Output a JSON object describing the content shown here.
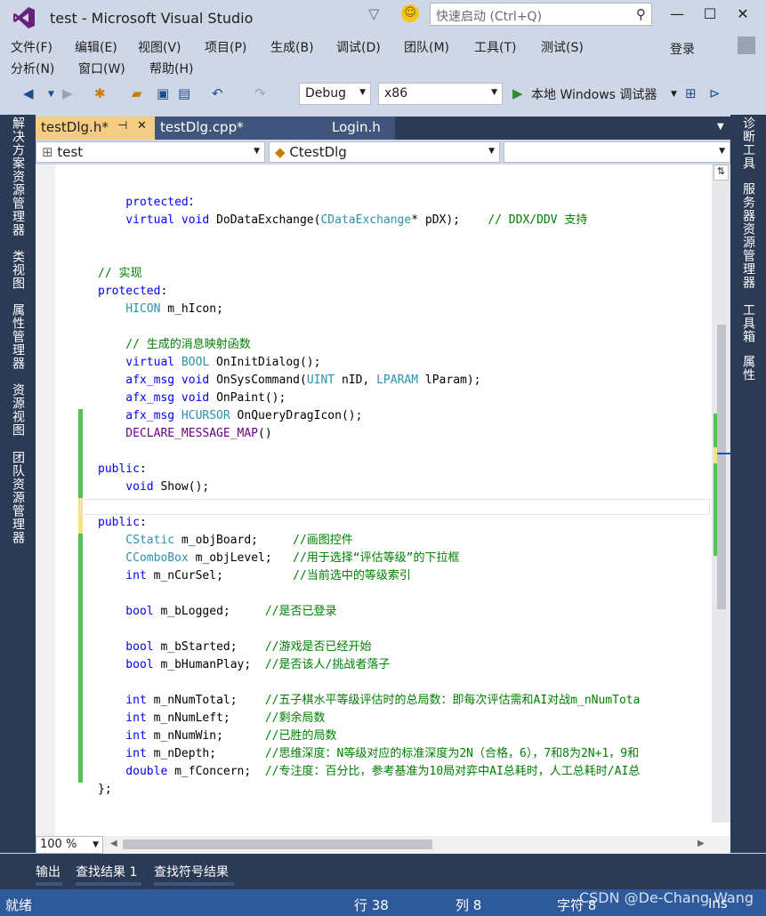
{
  "window": {
    "title": "test - Microsoft Visual Studio",
    "quick_launch_placeholder": "快速启动 (Ctrl+Q)",
    "min_icon": "minimize-icon",
    "max_icon": "maximize-icon",
    "close_icon": "close-icon"
  },
  "menu": {
    "row1": [
      "文件(F)",
      "编辑(E)",
      "视图(V)",
      "项目(P)",
      "生成(B)",
      "调试(D)",
      "团队(M)",
      "工具(T)",
      "测试(S)"
    ],
    "row2": [
      "分析(N)",
      "窗口(W)",
      "帮助(H)"
    ],
    "login": "登录"
  },
  "toolbar": {
    "config": "Debug",
    "platform": "x86",
    "debugger": "本地 Windows 调试器"
  },
  "left_rail": [
    "解决方案资源管理器",
    "类视图",
    "属性管理器",
    "资源视图",
    "团队资源管理器"
  ],
  "right_rail": [
    "诊断工具",
    "服务器资源管理器",
    "工具箱",
    "属性"
  ],
  "tabs": [
    {
      "label": "testDlg.h*",
      "pin": "⊣",
      "close": "✕"
    },
    {
      "label": "testDlg.cpp*"
    },
    {
      "label": "Login.h"
    }
  ],
  "nav": {
    "project": "test",
    "class": "CtestDlg",
    "member": ""
  },
  "code": [
    [],
    [
      [
        "kw",
        "    protected"
      ],
      [
        "",
        "："
      ]
    ],
    [
      [
        "kw",
        "    virtual void "
      ],
      [
        "",
        "DoDataExchange("
      ],
      [
        "ty",
        "CDataExchange"
      ],
      [
        "",
        "* pDX);    "
      ],
      [
        "cm",
        "// DDX/DDV 支持"
      ]
    ],
    [],
    [],
    [
      [
        "cm",
        "// 实现"
      ]
    ],
    [
      [
        "kw",
        "protected"
      ],
      [
        "",
        ":"
      ]
    ],
    [
      [
        "ty",
        "    HICON"
      ],
      [
        "",
        " m_hIcon;"
      ]
    ],
    [],
    [
      [
        "cm",
        "    // 生成的消息映射函数"
      ]
    ],
    [
      [
        "kw",
        "    virtual "
      ],
      [
        "ty",
        "BOOL"
      ],
      [
        "",
        " OnInitDialog();"
      ]
    ],
    [
      [
        "kw",
        "    afx_msg void "
      ],
      [
        "",
        "OnSysCommand("
      ],
      [
        "ty",
        "UINT"
      ],
      [
        "",
        " nID, "
      ],
      [
        "ty",
        "LPARAM"
      ],
      [
        "",
        " lParam);"
      ]
    ],
    [
      [
        "kw",
        "    afx_msg void "
      ],
      [
        "",
        "OnPaint();"
      ]
    ],
    [
      [
        "kw",
        "    afx_msg "
      ],
      [
        "ty",
        "HCURSOR"
      ],
      [
        "",
        " OnQueryDragIcon();"
      ]
    ],
    [
      [
        "mc",
        "    DECLARE_MESSAGE_MAP"
      ],
      [
        "",
        "()"
      ]
    ],
    [],
    [
      [
        "kw",
        "public"
      ],
      [
        "",
        ":"
      ]
    ],
    [
      [
        "kw",
        "    void "
      ],
      [
        "",
        "Show();"
      ]
    ],
    [],
    [
      [
        "kw",
        "public"
      ],
      [
        "",
        ":"
      ]
    ],
    [
      [
        "ty",
        "    CStatic"
      ],
      [
        "",
        " m_objBoard;     "
      ],
      [
        "cm",
        "//画图控件"
      ]
    ],
    [
      [
        "ty",
        "    CComboBox"
      ],
      [
        "",
        " m_objLevel;   "
      ],
      [
        "cm",
        "//用于选择“评估等级”的下拉框"
      ]
    ],
    [
      [
        "kw",
        "    int "
      ],
      [
        "",
        "m_nCurSel;          "
      ],
      [
        "cm",
        "//当前选中的等级索引"
      ]
    ],
    [],
    [
      [
        "kw",
        "    bool "
      ],
      [
        "",
        "m_bLogged;     "
      ],
      [
        "cm",
        "//是否已登录"
      ]
    ],
    [],
    [
      [
        "kw",
        "    bool "
      ],
      [
        "",
        "m_bStarted;    "
      ],
      [
        "cm",
        "//游戏是否已经开始"
      ]
    ],
    [
      [
        "kw",
        "    bool "
      ],
      [
        "",
        "m_bHumanPlay;  "
      ],
      [
        "cm",
        "//是否该人/挑战者落子"
      ]
    ],
    [],
    [
      [
        "kw",
        "    int "
      ],
      [
        "",
        "m_nNumTotal;    "
      ],
      [
        "cm",
        "//五子棋水平等级评估时的总局数：即每次评估需和AI对战m_nNumTota"
      ]
    ],
    [
      [
        "kw",
        "    int "
      ],
      [
        "",
        "m_nNumLeft;     "
      ],
      [
        "cm",
        "//剩余局数"
      ]
    ],
    [
      [
        "kw",
        "    int "
      ],
      [
        "",
        "m_nNumWin;      "
      ],
      [
        "cm",
        "//已胜的局数"
      ]
    ],
    [
      [
        "kw",
        "    int "
      ],
      [
        "",
        "m_nDepth;       "
      ],
      [
        "cm",
        "//思维深度：N等级对应的标准深度为2N（合格，6），7和8为2N+1，9和"
      ]
    ],
    [
      [
        "kw",
        "    double "
      ],
      [
        "",
        "m_fConcern;  "
      ],
      [
        "cm",
        "//专注度：百分比，参考基准为10局对弈中AI总耗时，人工总耗时/AI总"
      ]
    ],
    [
      [
        "",
        "};"
      ]
    ]
  ],
  "zoom": "100 %",
  "bottom_tabs": [
    "输出",
    "查找结果 1",
    "查找符号结果"
  ],
  "status": {
    "ready": "就绪",
    "row": "行 38",
    "col": "列 8",
    "ch": "字符 8",
    "ins": "Ins"
  },
  "watermark": "CSDN @De-Chang Wang"
}
